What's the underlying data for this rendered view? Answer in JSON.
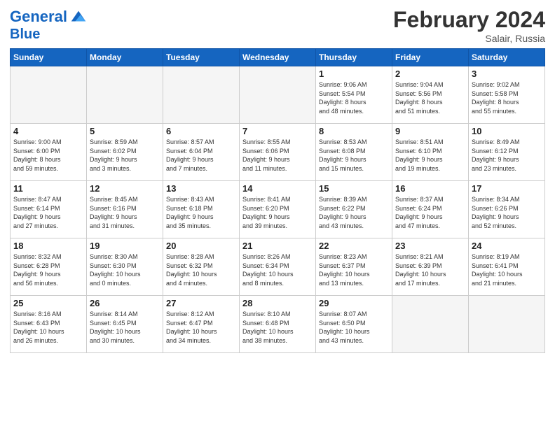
{
  "header": {
    "logo_line1": "General",
    "logo_line2": "Blue",
    "month": "February 2024",
    "location": "Salair, Russia"
  },
  "days_header": [
    "Sunday",
    "Monday",
    "Tuesday",
    "Wednesday",
    "Thursday",
    "Friday",
    "Saturday"
  ],
  "weeks": [
    [
      {
        "num": "",
        "info": ""
      },
      {
        "num": "",
        "info": ""
      },
      {
        "num": "",
        "info": ""
      },
      {
        "num": "",
        "info": ""
      },
      {
        "num": "1",
        "info": "Sunrise: 9:06 AM\nSunset: 5:54 PM\nDaylight: 8 hours\nand 48 minutes."
      },
      {
        "num": "2",
        "info": "Sunrise: 9:04 AM\nSunset: 5:56 PM\nDaylight: 8 hours\nand 51 minutes."
      },
      {
        "num": "3",
        "info": "Sunrise: 9:02 AM\nSunset: 5:58 PM\nDaylight: 8 hours\nand 55 minutes."
      }
    ],
    [
      {
        "num": "4",
        "info": "Sunrise: 9:00 AM\nSunset: 6:00 PM\nDaylight: 8 hours\nand 59 minutes."
      },
      {
        "num": "5",
        "info": "Sunrise: 8:59 AM\nSunset: 6:02 PM\nDaylight: 9 hours\nand 3 minutes."
      },
      {
        "num": "6",
        "info": "Sunrise: 8:57 AM\nSunset: 6:04 PM\nDaylight: 9 hours\nand 7 minutes."
      },
      {
        "num": "7",
        "info": "Sunrise: 8:55 AM\nSunset: 6:06 PM\nDaylight: 9 hours\nand 11 minutes."
      },
      {
        "num": "8",
        "info": "Sunrise: 8:53 AM\nSunset: 6:08 PM\nDaylight: 9 hours\nand 15 minutes."
      },
      {
        "num": "9",
        "info": "Sunrise: 8:51 AM\nSunset: 6:10 PM\nDaylight: 9 hours\nand 19 minutes."
      },
      {
        "num": "10",
        "info": "Sunrise: 8:49 AM\nSunset: 6:12 PM\nDaylight: 9 hours\nand 23 minutes."
      }
    ],
    [
      {
        "num": "11",
        "info": "Sunrise: 8:47 AM\nSunset: 6:14 PM\nDaylight: 9 hours\nand 27 minutes."
      },
      {
        "num": "12",
        "info": "Sunrise: 8:45 AM\nSunset: 6:16 PM\nDaylight: 9 hours\nand 31 minutes."
      },
      {
        "num": "13",
        "info": "Sunrise: 8:43 AM\nSunset: 6:18 PM\nDaylight: 9 hours\nand 35 minutes."
      },
      {
        "num": "14",
        "info": "Sunrise: 8:41 AM\nSunset: 6:20 PM\nDaylight: 9 hours\nand 39 minutes."
      },
      {
        "num": "15",
        "info": "Sunrise: 8:39 AM\nSunset: 6:22 PM\nDaylight: 9 hours\nand 43 minutes."
      },
      {
        "num": "16",
        "info": "Sunrise: 8:37 AM\nSunset: 6:24 PM\nDaylight: 9 hours\nand 47 minutes."
      },
      {
        "num": "17",
        "info": "Sunrise: 8:34 AM\nSunset: 6:26 PM\nDaylight: 9 hours\nand 52 minutes."
      }
    ],
    [
      {
        "num": "18",
        "info": "Sunrise: 8:32 AM\nSunset: 6:28 PM\nDaylight: 9 hours\nand 56 minutes."
      },
      {
        "num": "19",
        "info": "Sunrise: 8:30 AM\nSunset: 6:30 PM\nDaylight: 10 hours\nand 0 minutes."
      },
      {
        "num": "20",
        "info": "Sunrise: 8:28 AM\nSunset: 6:32 PM\nDaylight: 10 hours\nand 4 minutes."
      },
      {
        "num": "21",
        "info": "Sunrise: 8:26 AM\nSunset: 6:34 PM\nDaylight: 10 hours\nand 8 minutes."
      },
      {
        "num": "22",
        "info": "Sunrise: 8:23 AM\nSunset: 6:37 PM\nDaylight: 10 hours\nand 13 minutes."
      },
      {
        "num": "23",
        "info": "Sunrise: 8:21 AM\nSunset: 6:39 PM\nDaylight: 10 hours\nand 17 minutes."
      },
      {
        "num": "24",
        "info": "Sunrise: 8:19 AM\nSunset: 6:41 PM\nDaylight: 10 hours\nand 21 minutes."
      }
    ],
    [
      {
        "num": "25",
        "info": "Sunrise: 8:16 AM\nSunset: 6:43 PM\nDaylight: 10 hours\nand 26 minutes."
      },
      {
        "num": "26",
        "info": "Sunrise: 8:14 AM\nSunset: 6:45 PM\nDaylight: 10 hours\nand 30 minutes."
      },
      {
        "num": "27",
        "info": "Sunrise: 8:12 AM\nSunset: 6:47 PM\nDaylight: 10 hours\nand 34 minutes."
      },
      {
        "num": "28",
        "info": "Sunrise: 8:10 AM\nSunset: 6:48 PM\nDaylight: 10 hours\nand 38 minutes."
      },
      {
        "num": "29",
        "info": "Sunrise: 8:07 AM\nSunset: 6:50 PM\nDaylight: 10 hours\nand 43 minutes."
      },
      {
        "num": "",
        "info": ""
      },
      {
        "num": "",
        "info": ""
      }
    ]
  ]
}
